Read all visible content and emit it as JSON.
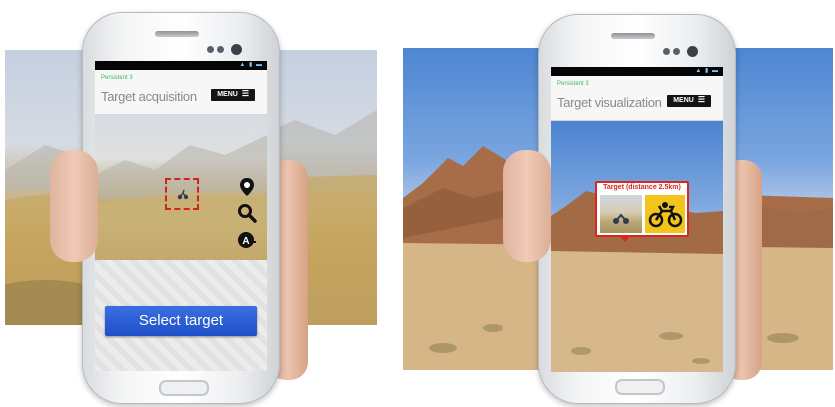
{
  "left_screen": {
    "small_title": "Persistent 3",
    "title": "Target acquisition",
    "menu_label": "MENU",
    "menu_icon": "hamburger-icon",
    "map_icons": [
      "location-pin-icon",
      "magnifier-zoom-icon",
      "avatar-action-icon"
    ],
    "select_button_label": "Select target"
  },
  "right_screen": {
    "small_title": "Persistent 3",
    "title": "Target visualization",
    "menu_label": "MENU",
    "menu_icon": "hamburger-icon",
    "callout_title": "Target (distance 2.5km)",
    "vehicle_icon": "motorcycle-icon",
    "colors": {
      "callout_border": "#d9261f",
      "vehicle_bg": "#f3c41c"
    }
  },
  "colors": {
    "accent_green": "#3fb65a",
    "button_blue": "#1f4fc8",
    "target_red": "#d22222"
  }
}
